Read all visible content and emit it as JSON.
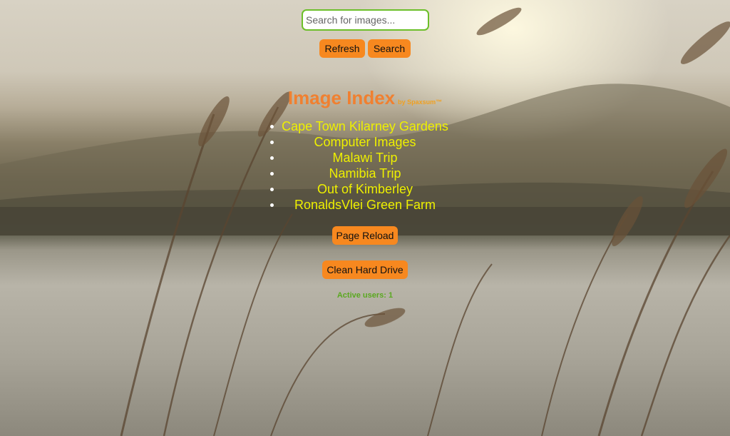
{
  "search": {
    "placeholder": "Search for images...",
    "value": ""
  },
  "toolbar": {
    "refresh_label": "Refresh",
    "search_label": "Search"
  },
  "header": {
    "title": "Image Index",
    "byline": "by Spaxsum™"
  },
  "albums": [
    {
      "label": "Cape Town Kilarney Gardens"
    },
    {
      "label": "Computer Images"
    },
    {
      "label": "Malawi Trip"
    },
    {
      "label": "Namibia Trip"
    },
    {
      "label": "Out of Kimberley"
    },
    {
      "label": "RonaldsVlei Green Farm"
    }
  ],
  "actions": {
    "page_reload_label": "Page Reload",
    "clean_drive_label": "Clean Hard Drive"
  },
  "status": {
    "active_users_text": "Active users: 1"
  },
  "colors": {
    "button_bg": "#f7881f",
    "title": "#f08030",
    "album_link": "#eef000",
    "search_border": "#6cbf2a",
    "active_users": "#5aa820"
  }
}
